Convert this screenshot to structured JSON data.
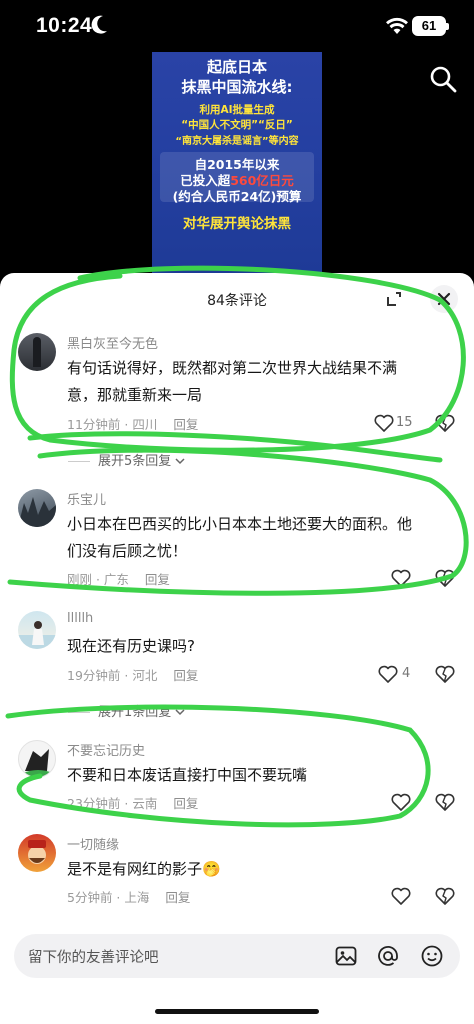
{
  "status_bar": {
    "time": "10:24",
    "battery": "61"
  },
  "video": {
    "title_line1": "起底日本",
    "title_line2": "抹黑中国流水线:",
    "yellow_line1": "利用AI批量生成",
    "yellow_line2": "“中国人不文明”“反日”",
    "yellow_line3": "“南京大屠杀是谣言”等内容",
    "white_line1": "自2015年以来",
    "white_line2_pre": "已投入超",
    "white_line2_hl": "560亿日元",
    "white_line3": "(约合人民币24亿)预算",
    "slogan": "对华展开舆论抹黑"
  },
  "sheet": {
    "title": "84条评论"
  },
  "comments": [
    {
      "name": "黑白灰至今无色",
      "line1": "有句话说得好，既然都对第二次世界大战结果不满",
      "line2": "意，那就重新来一局",
      "time_loc": "11分钟前 · 四川",
      "reply": "回复",
      "likes": "15"
    },
    {
      "name": "乐宝儿",
      "line1": "小日本在巴西买的比小日本本土地还要大的面积。他",
      "line2": "们没有后顾之忧！",
      "time_loc": "刚刚 · 广东",
      "reply": "回复",
      "likes": ""
    },
    {
      "name": "lllllh",
      "line1": "现在还有历史课吗?",
      "line2": "",
      "time_loc": "19分钟前 · 河北",
      "reply": "回复",
      "likes": "4"
    },
    {
      "name": "不要忘记历史",
      "line1": "不要和日本废话直接打中国不要玩嘴",
      "line2": "",
      "time_loc": "23分钟前 · 云南",
      "reply": "回复",
      "likes": ""
    },
    {
      "name": "一切随缘",
      "line1": "是不是有网红的影子🤭",
      "line2": "",
      "time_loc": "5分钟前 · 上海",
      "reply": "回复",
      "likes": ""
    }
  ],
  "expand_replies": [
    "展开5条回复",
    "展开1条回复"
  ],
  "input": {
    "placeholder": "留下你的友善评论吧"
  },
  "colors": {
    "annotation_green": "#3dd24a",
    "video_blue": "#2540a2",
    "highlight_yellow": "#ffe43a"
  }
}
